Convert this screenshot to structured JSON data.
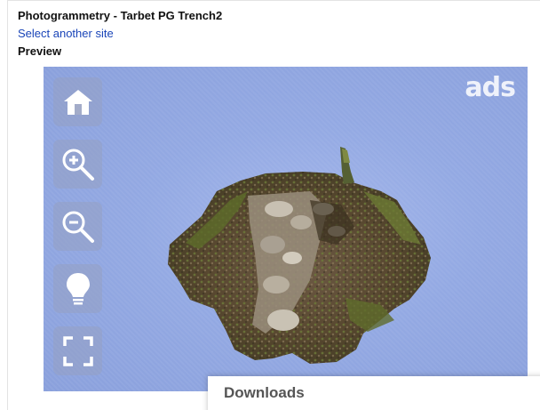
{
  "page": {
    "title": "Photogrammetry - Tarbet PG Trench2",
    "select_site_link": "Select another site",
    "preview_label": "Preview"
  },
  "viewer": {
    "logo_text": "ads",
    "background_color": "#93a9e3",
    "controls": [
      {
        "name": "home",
        "icon": "home-icon"
      },
      {
        "name": "zoom-in",
        "icon": "zoom-in-icon"
      },
      {
        "name": "zoom-out",
        "icon": "zoom-out-icon"
      },
      {
        "name": "lighting",
        "icon": "lightbulb-icon"
      },
      {
        "name": "fullscreen",
        "icon": "fullscreen-icon"
      }
    ]
  },
  "downloads": {
    "title": "Downloads"
  }
}
